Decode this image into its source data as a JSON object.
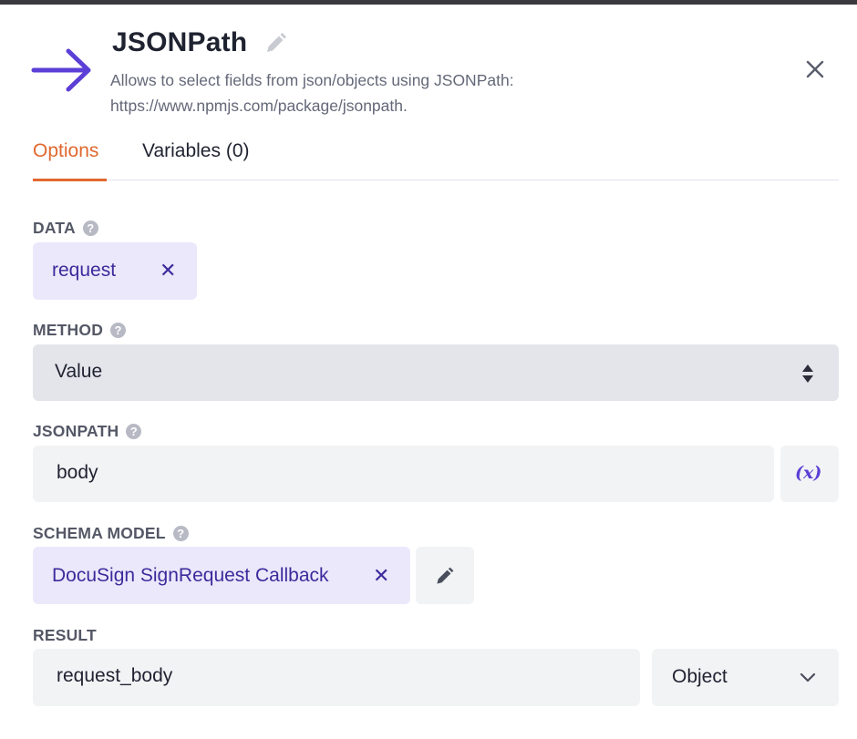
{
  "header": {
    "title": "JSONPath",
    "description": "Allows to select fields from json/objects using JSONPath: https://www.npmjs.com/package/jsonpath.",
    "icon": "arrow-right-icon",
    "accent_color": "#5b3fd6"
  },
  "tabs": [
    {
      "label": "Options",
      "active": true
    },
    {
      "label": "Variables (0)",
      "active": false
    }
  ],
  "fields": {
    "data": {
      "label": "DATA",
      "chip": "request"
    },
    "method": {
      "label": "METHOD",
      "value": "Value"
    },
    "jsonpath": {
      "label": "JSONPATH",
      "value": "body",
      "variable_button": "(x)"
    },
    "schema_model": {
      "label": "SCHEMA MODEL",
      "chip": "DocuSign SignRequest Callback"
    },
    "result": {
      "label": "RESULT",
      "value": "request_body",
      "type": "Object"
    }
  },
  "colors": {
    "tab_active": "#e0682e",
    "chip_bg": "#ebe8fb",
    "chip_text": "#3d2a9b"
  }
}
